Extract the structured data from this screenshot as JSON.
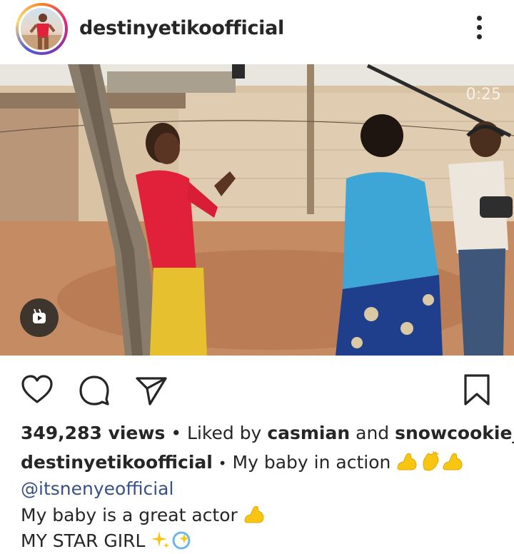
{
  "header": {
    "username": "destinyetikoofficial"
  },
  "media": {
    "timestamp": "0:25"
  },
  "engagement": {
    "views": "349,283 views",
    "separator": "•",
    "liked_by_prefix": "Liked by",
    "liker_1": "casmian",
    "and_word": "and",
    "liker_2": "snowcookie__"
  },
  "caption": {
    "username": "destinyetikoofficial",
    "separator": "•",
    "text": "My baby in action",
    "mention": "@itsnenyeofficial",
    "line2": "My baby is a great actor",
    "line3": "MY STAR GIRL"
  },
  "icons": {
    "more": "more-vertical-icon",
    "like": "heart-icon",
    "comment": "comment-icon",
    "share": "paper-plane-icon",
    "save": "bookmark-icon",
    "reels": "reels-icon"
  },
  "colors": {
    "text": "#262626",
    "mention": "#385185",
    "emoji_yellow": "#f9c513"
  }
}
